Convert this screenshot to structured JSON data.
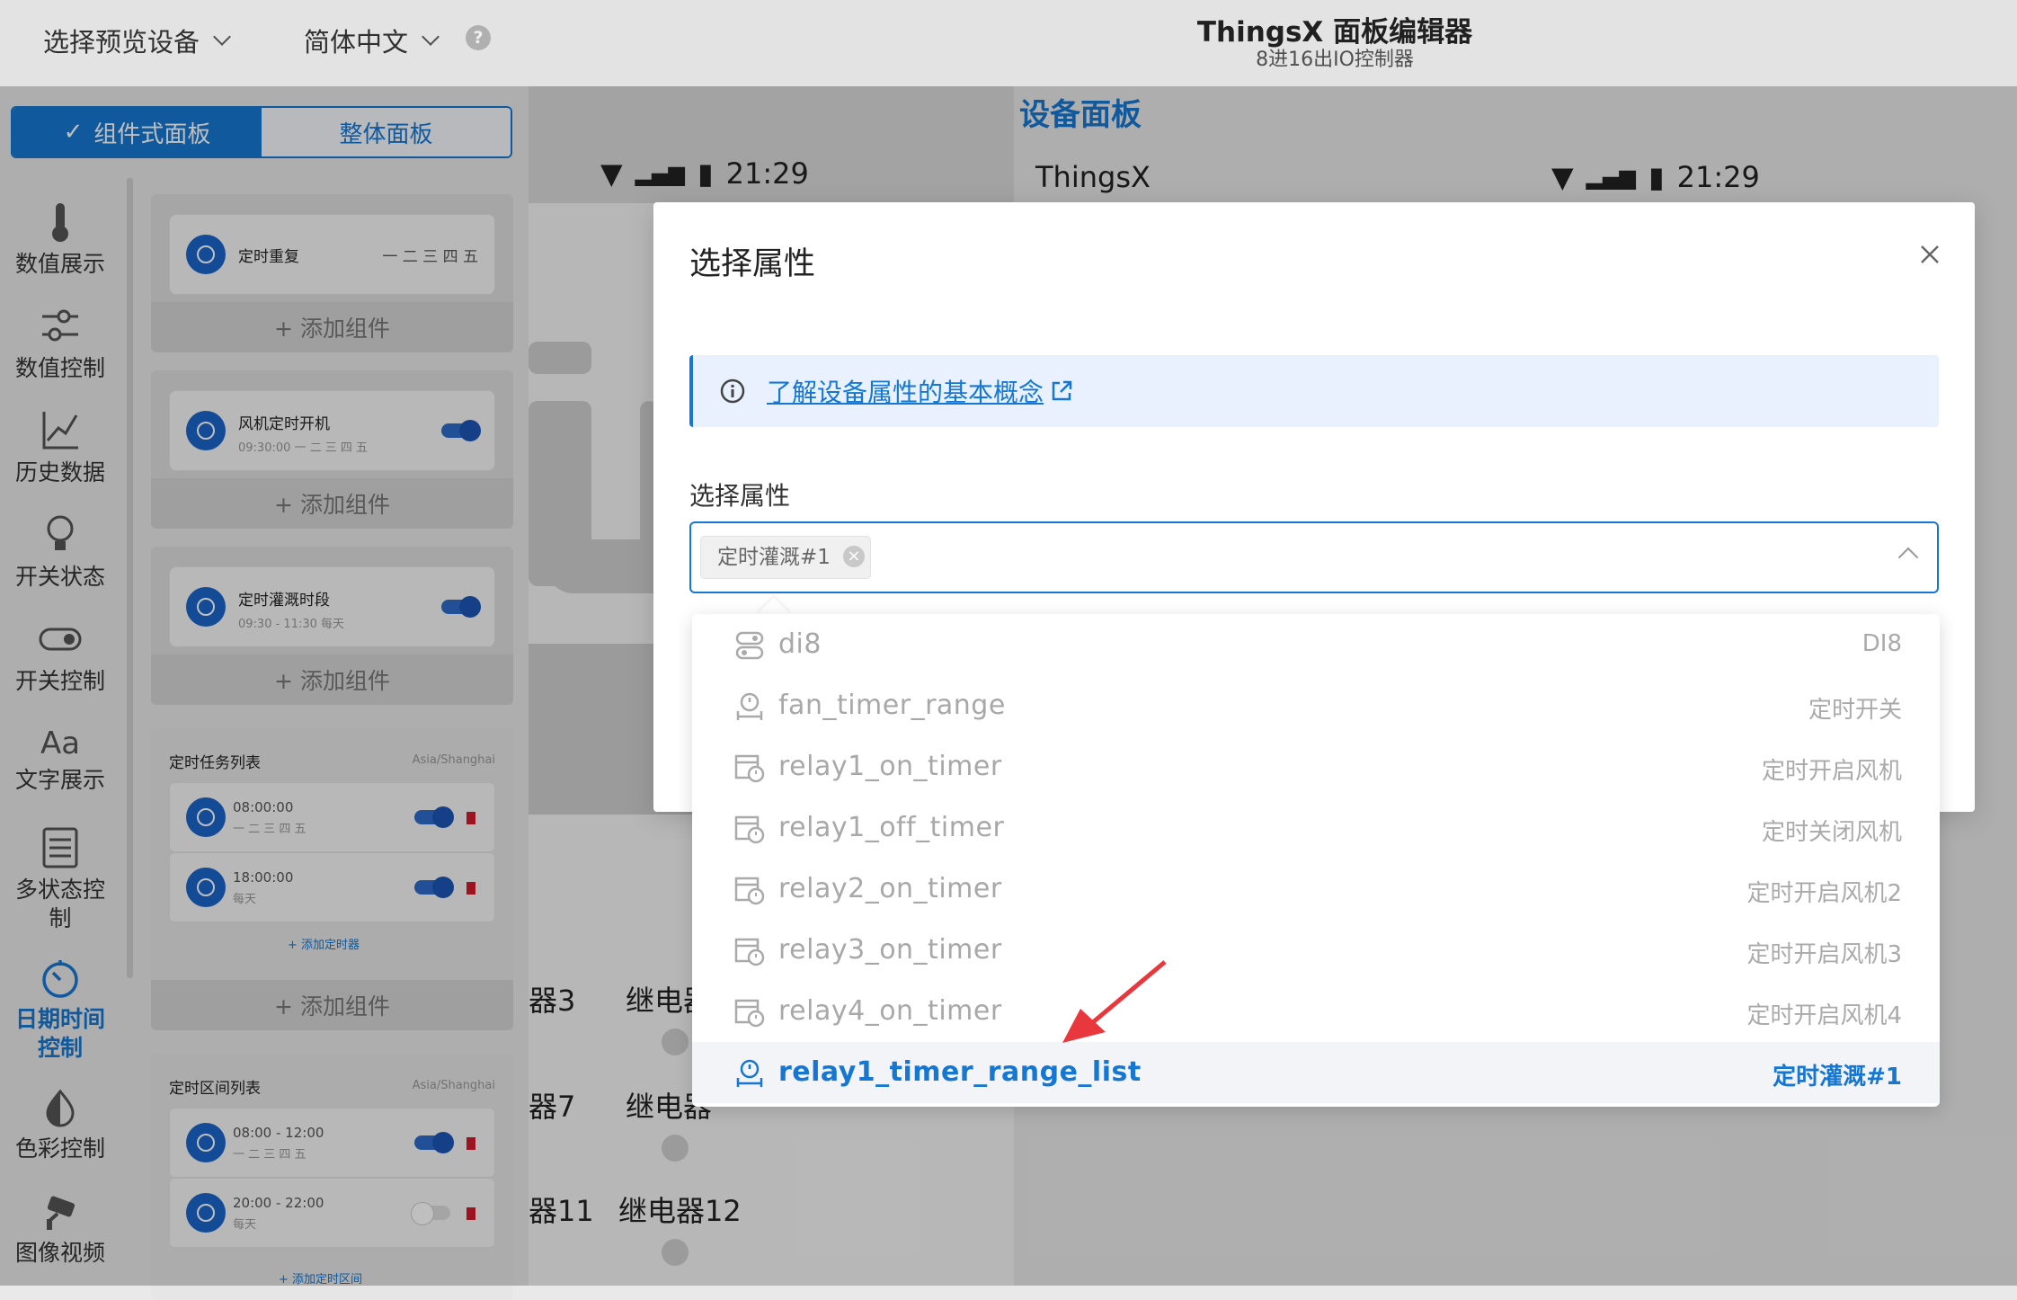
{
  "topbar": {
    "device_select": "选择预览设备",
    "language_select": "简体中文",
    "help_icon": "?",
    "title": "ThingsX 面板编辑器",
    "subtitle": "8进16出IO控制器"
  },
  "mode_tabs": {
    "component": "组件式面板",
    "whole": "整体面板"
  },
  "sidebar": {
    "items": [
      {
        "label": "数值展示",
        "icon": "thermometer-icon"
      },
      {
        "label": "数值控制",
        "icon": "sliders-icon"
      },
      {
        "label": "历史数据",
        "icon": "chart-line-icon"
      },
      {
        "label": "开关状态",
        "icon": "bulb-icon"
      },
      {
        "label": "开关控制",
        "icon": "toggle-icon"
      },
      {
        "label": "文字展示",
        "icon": "text-icon"
      },
      {
        "label": "多状态控",
        "label2": "制",
        "icon": "list-icon"
      },
      {
        "label": "日期时间",
        "label2": "控制",
        "icon": "timer-icon",
        "active": true
      },
      {
        "label": "色彩控制",
        "icon": "color-drop-icon"
      },
      {
        "label": "图像视频",
        "icon": "camera-icon"
      }
    ]
  },
  "widgets": {
    "timer_repeat": {
      "title": "定时重复",
      "days": "一 二 三 四 五"
    },
    "fan_timer": {
      "title": "风机定时开机",
      "sub": "09:30:00 一 二 三 四 五"
    },
    "irrigation": {
      "title": "定时灌溉时段",
      "sub": "09:30 - 11:30 每天"
    },
    "add_component": "+ 添加组件",
    "task_list": {
      "title": "定时任务列表",
      "tz": "Asia/Shanghai",
      "rows": [
        {
          "time": "08:00:00",
          "days": "一 二 三 四 五"
        },
        {
          "time": "18:00:00",
          "days": "每天"
        }
      ],
      "add": "+ 添加定时器"
    },
    "range_list": {
      "title": "定时区间列表",
      "tz": "Asia/Shanghai",
      "rows": [
        {
          "time": "08:00 - 12:00",
          "days": "一 二 三 四 五"
        },
        {
          "time": "20:00 - 22:00",
          "days": "每天"
        }
      ],
      "add": "+ 添加定时区间"
    }
  },
  "preview": {
    "time": "21:29",
    "relay_labels": [
      "器3",
      "继电器",
      "器7",
      "继电器",
      "器11",
      "继电器12"
    ]
  },
  "device_panel": {
    "heading": "设备面板",
    "brand": "ThingsX",
    "time": "21:29"
  },
  "modal": {
    "title": "选择属性",
    "info_link": "了解设备属性的基本概念",
    "field_label": "选择属性",
    "selected_tag": "定时灌溉#1",
    "options": [
      {
        "name": "di8",
        "desc": "DI8",
        "icon": "toggle-switch-icon"
      },
      {
        "name": "fan_timer_range",
        "desc": "定时开关",
        "icon": "timer-range-icon"
      },
      {
        "name": "relay1_on_timer",
        "desc": "定时开启风机",
        "icon": "calendar-clock-icon"
      },
      {
        "name": "relay1_off_timer",
        "desc": "定时关闭风机",
        "icon": "calendar-clock-icon"
      },
      {
        "name": "relay2_on_timer",
        "desc": "定时开启风机2",
        "icon": "calendar-clock-icon"
      },
      {
        "name": "relay3_on_timer",
        "desc": "定时开启风机3",
        "icon": "calendar-clock-icon"
      },
      {
        "name": "relay4_on_timer",
        "desc": "定时开启风机4",
        "icon": "calendar-clock-icon"
      },
      {
        "name": "relay1_timer_range_list",
        "desc": "定时灌溉#1",
        "icon": "timer-range-icon",
        "selected": true
      }
    ]
  },
  "colors": {
    "primary": "#1677d2",
    "danger": "#d21a2a",
    "annotation_arrow": "#e8383d"
  }
}
